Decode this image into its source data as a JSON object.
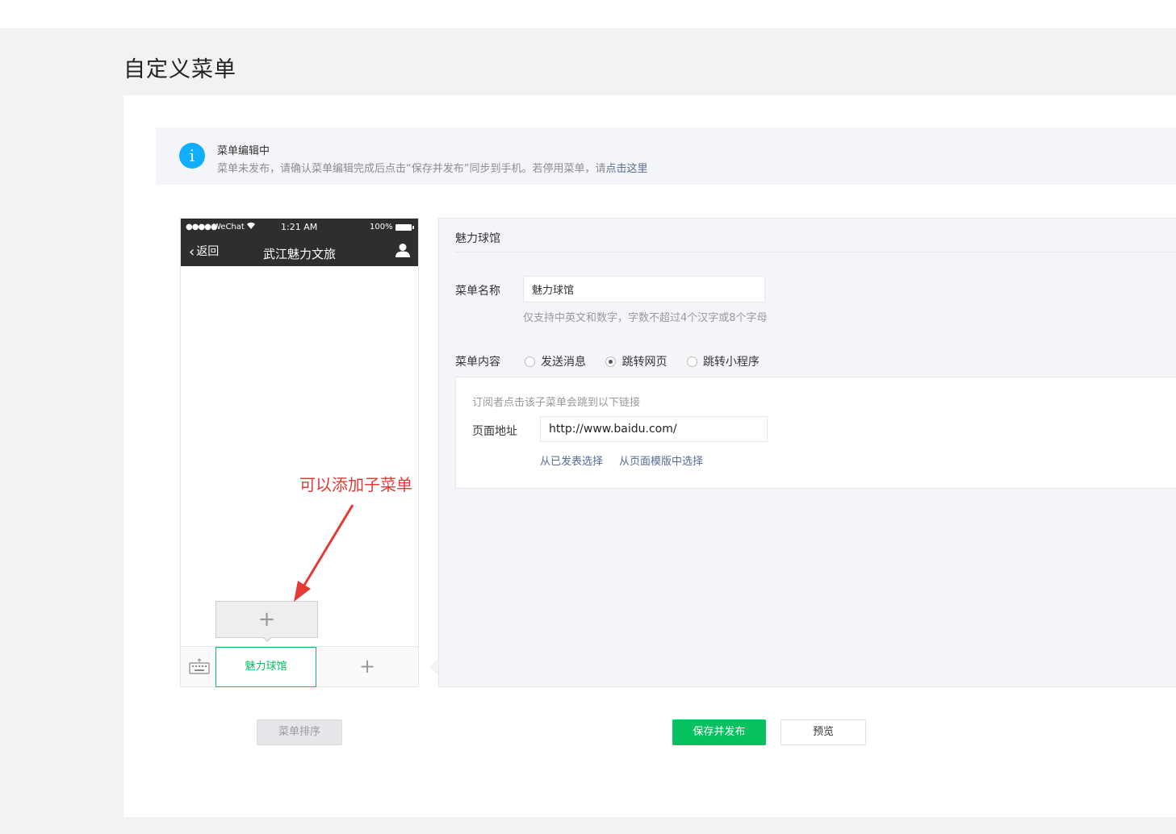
{
  "page": {
    "title": "自定义菜单"
  },
  "notice": {
    "icon": "info-icon",
    "icon_glyph": "i",
    "title": "菜单编辑中",
    "desc": "菜单未发布，请确认菜单编辑完成后点击“保存并发布”同步到手机。若停用菜单，请",
    "link": "点击这里"
  },
  "phone": {
    "status": {
      "signal": "●●●●●",
      "carrier": "WeChat",
      "time": "1:21 AM",
      "battery": "100%"
    },
    "back_label": "返回",
    "account_name": "武江魅力文旅",
    "sub_add": "+",
    "menu_items": [
      {
        "label": "魅力球馆",
        "active": true
      }
    ],
    "menu_add": "+"
  },
  "annotation": {
    "text": "可以添加子菜单",
    "color": "#e53935"
  },
  "editor": {
    "title": "魅力球馆",
    "name_label": "菜单名称",
    "name_value": "魅力球馆",
    "name_hint": "仅支持中英文和数字，字数不超过4个汉字或8个字母",
    "content_label": "菜单内容",
    "content_options": [
      {
        "label": "发送消息",
        "checked": false
      },
      {
        "label": "跳转网页",
        "checked": true
      },
      {
        "label": "跳转小程序",
        "checked": false
      }
    ],
    "url_desc": "订阅者点击该子菜单会跳到以下链接",
    "url_label": "页面地址",
    "url_value": "http://www.baidu.com/",
    "url_link_published": "从已发表选择",
    "url_link_template": "从页面模版中选择"
  },
  "buttons": {
    "sort": "菜单排序",
    "save": "保存并发布",
    "preview": "预览"
  },
  "colors": {
    "accent": "#07c160",
    "link": "#576b95",
    "info": "#10aeff",
    "phone_header": "#2e2e2e"
  }
}
